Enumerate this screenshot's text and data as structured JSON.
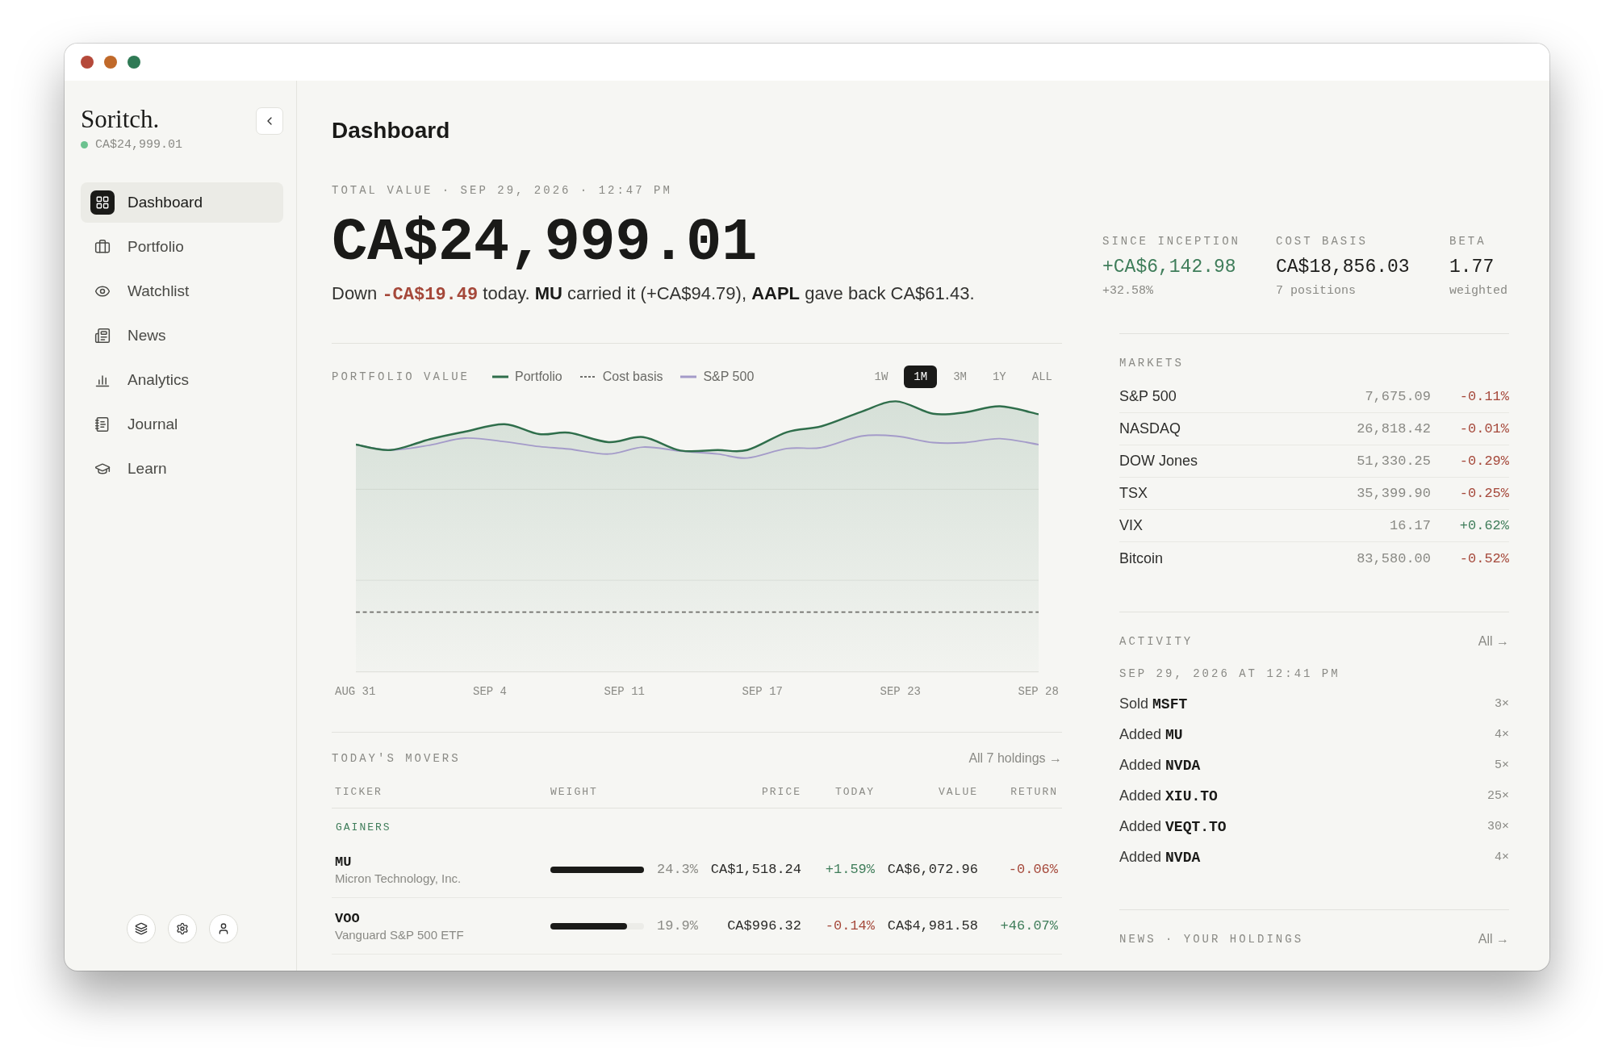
{
  "sidebar": {
    "brand": "Soritch.",
    "balance": "CA$24,999.01",
    "nav": [
      {
        "label": "Dashboard",
        "selected": true
      },
      {
        "label": "Portfolio",
        "selected": false
      },
      {
        "label": "Watchlist",
        "selected": false
      },
      {
        "label": "News",
        "selected": false
      },
      {
        "label": "Analytics",
        "selected": false
      },
      {
        "label": "Journal",
        "selected": false
      },
      {
        "label": "Learn",
        "selected": false
      }
    ]
  },
  "header": {
    "title": "Dashboard"
  },
  "total": {
    "label": "TOTAL VALUE · SEP 29, 2026 · 12:47 PM",
    "value": "CA$24,999.01",
    "summary": {
      "lead": "Down",
      "change": {
        "text": "-CA$19.49",
        "color": "#a5483a"
      },
      "rest": "today. **MU** carried it (+CA$94.79), **AAPL** gave back CA$61.43."
    }
  },
  "stats": [
    {
      "label": "SINCE INCEPTION",
      "value": "+CA$6,142.98",
      "color": "#3f7d5a",
      "note": "+32.58%"
    },
    {
      "label": "COST BASIS",
      "value": "CA$18,856.03",
      "color": "#1d1d1b",
      "note": "7 positions"
    },
    {
      "label": "BETA",
      "value": "1.77",
      "color": "#1d1d1b",
      "note": "weighted"
    }
  ],
  "chart": {
    "title": "PORTFOLIO VALUE",
    "legend": [
      {
        "label": "Portfolio",
        "kind": "solid",
        "color": "#2f6e4b"
      },
      {
        "label": "Cost basis",
        "kind": "dashed",
        "color": "#6f6f6b"
      },
      {
        "label": "S&P 500",
        "kind": "solid",
        "color": "#a49bc9"
      }
    ],
    "ranges": [
      {
        "label": "1W",
        "selected": false
      },
      {
        "label": "1M",
        "selected": true
      },
      {
        "label": "3M",
        "selected": false
      },
      {
        "label": "1Y",
        "selected": false
      },
      {
        "label": "ALL",
        "selected": false
      }
    ],
    "x_labels": [
      "AUG 31",
      "SEP 4",
      "SEP 11",
      "SEP 17",
      "SEP 23",
      "SEP 28"
    ]
  },
  "movers": {
    "title": "TODAY'S MOVERS",
    "link": "All 7 holdings →",
    "columns": [
      "TICKER",
      "WEIGHT",
      "PRICE",
      "TODAY",
      "VALUE",
      "RETURN"
    ],
    "group": "GAINERS",
    "rows": [
      {
        "ticker": "MU",
        "name": "Micron Technology, Inc.",
        "level": 1,
        "weight": "24.3%",
        "price": "CA$1,518.24",
        "today": {
          "text": "+1.59%",
          "color": "#3f7d5a"
        },
        "value": "CA$6,072.96",
        "return": {
          "text": "-0.06%",
          "color": "#a5483a"
        }
      },
      {
        "ticker": "VOO",
        "name": "Vanguard S&P 500 ETF",
        "level": 0.82,
        "weight": "19.9%",
        "price": "CA$996.32",
        "today": {
          "text": "-0.14%",
          "color": "#a5483a"
        },
        "value": "CA$4,981.58",
        "return": {
          "text": "+46.07%",
          "color": "#3f7d5a"
        }
      }
    ]
  },
  "markets": {
    "title": "MARKETS",
    "rows": [
      {
        "name": "S&P 500",
        "price": "7,675.09",
        "change": "-0.11%",
        "color": "#a5483a"
      },
      {
        "name": "NASDAQ",
        "price": "26,818.42",
        "change": "-0.01%",
        "color": "#a5483a"
      },
      {
        "name": "DOW Jones",
        "price": "51,330.25",
        "change": "-0.29%",
        "color": "#a5483a"
      },
      {
        "name": "TSX",
        "price": "35,399.90",
        "change": "-0.25%",
        "color": "#a5483a"
      },
      {
        "name": "VIX",
        "price": "16.17",
        "change": "+0.62%",
        "color": "#3f7d5a"
      },
      {
        "name": "Bitcoin",
        "price": "83,580.00",
        "change": "-0.52%",
        "color": "#a5483a"
      }
    ]
  },
  "activity": {
    "title": "ACTIVITY",
    "link": "All →",
    "date": "SEP 29, 2026 AT 12:41 PM",
    "items": [
      {
        "action": "Sold",
        "ticker": "MSFT",
        "quantity": "3×"
      },
      {
        "action": "Added",
        "ticker": "MU",
        "quantity": "4×"
      },
      {
        "action": "Added",
        "ticker": "NVDA",
        "quantity": "5×"
      },
      {
        "action": "Added",
        "ticker": "XIU.TO",
        "quantity": "25×"
      },
      {
        "action": "Added",
        "ticker": "VEQT.TO",
        "quantity": "30×"
      },
      {
        "action": "Added",
        "ticker": "NVDA",
        "quantity": "4×"
      }
    ]
  },
  "news": {
    "title": "NEWS · YOUR HOLDINGS",
    "link": "All →"
  }
}
